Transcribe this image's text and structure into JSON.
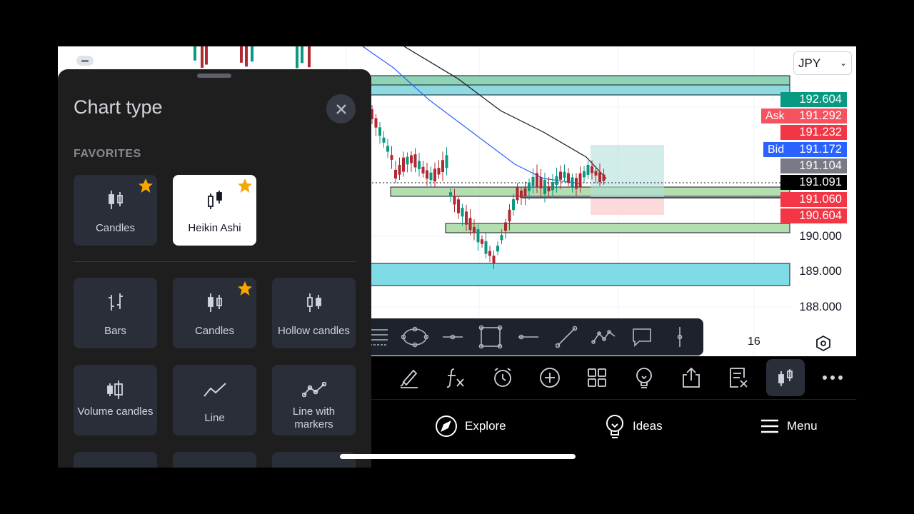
{
  "chart": {
    "currency_selector": "JPY",
    "price_labels": [
      {
        "text": "192.604",
        "bg": "#089981"
      },
      {
        "text": "191.292",
        "bg": "#f7525f"
      },
      {
        "text": "191.232",
        "bg": "#f23645"
      },
      {
        "text": "191.172",
        "bg": "#2962ff"
      },
      {
        "text": "191.104",
        "bg": "#787b86"
      },
      {
        "text": "191.091",
        "bg": "#000000"
      },
      {
        "text": "191.060",
        "bg": "#f23645"
      },
      {
        "text": "190.604",
        "bg": "#f23645"
      }
    ],
    "ask_label": "Ask",
    "bid_label": "Bid",
    "axis_labels": [
      "190.000",
      "189.000",
      "188.000"
    ],
    "time_label": "16"
  },
  "draw_toolbar": {
    "icons": [
      "fib-retracement-icon",
      "ellipse-icon",
      "horizontal-ray-icon",
      "rectangle-icon",
      "horizontal-line-icon",
      "trend-line-icon",
      "path-icon",
      "callout-icon",
      "vertical-line-icon"
    ]
  },
  "tool_row": {
    "icons": [
      "brush-icon",
      "indicators-icon",
      "alert-icon",
      "add-icon",
      "layouts-icon",
      "idea-icon",
      "share-icon",
      "remove-drawings-icon",
      "chart-type-icon",
      "more-icon"
    ],
    "active": "chart-type-icon"
  },
  "nav": {
    "explore": "Explore",
    "ideas": "Ideas",
    "menu": "Menu"
  },
  "panel": {
    "title": "Chart type",
    "favorites_header": "FAVORITES",
    "favorites": [
      {
        "label": "Candles",
        "starred": true,
        "selected": false
      },
      {
        "label": "Heikin Ashi",
        "starred": true,
        "selected": true
      }
    ],
    "types": [
      {
        "label": "Bars",
        "starred": false
      },
      {
        "label": "Candles",
        "starred": true
      },
      {
        "label": "Hollow candles",
        "starred": false
      },
      {
        "label": "Volume candles",
        "starred": false
      },
      {
        "label": "Line",
        "starred": false
      },
      {
        "label": "Line with markers",
        "starred": false
      }
    ],
    "star_color": "#f7a600"
  }
}
